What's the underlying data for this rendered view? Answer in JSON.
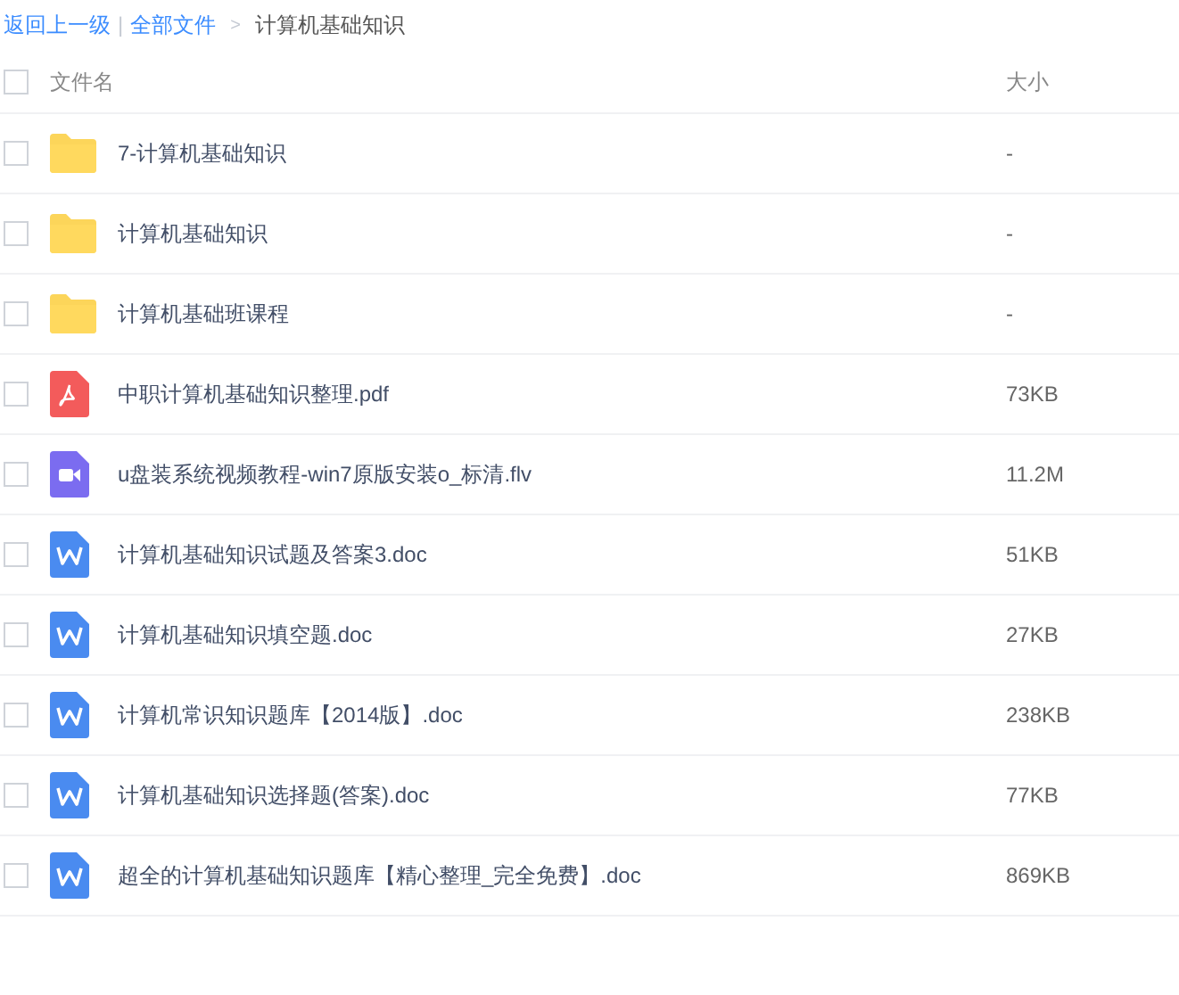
{
  "breadcrumb": {
    "back": "返回上一级",
    "divider": "|",
    "root": "全部文件",
    "separator": ">",
    "current": "计算机基础知识"
  },
  "table": {
    "columns": [
      "文件名",
      "大小"
    ],
    "header_checked": false,
    "rows": [
      {
        "kind": "folder",
        "name": "7-计算机基础知识",
        "size": "-",
        "checked": false
      },
      {
        "kind": "folder",
        "name": "计算机基础知识",
        "size": "-",
        "checked": false
      },
      {
        "kind": "folder",
        "name": "计算机基础班课程",
        "size": "-",
        "checked": false
      },
      {
        "kind": "pdf",
        "name": "中职计算机基础知识整理.pdf",
        "size": "73KB",
        "checked": false
      },
      {
        "kind": "video",
        "name": "u盘装系统视频教程-win7原版安装o_标清.flv",
        "size": "11.2M",
        "checked": false
      },
      {
        "kind": "doc",
        "name": "计算机基础知识试题及答案3.doc",
        "size": "51KB",
        "checked": false
      },
      {
        "kind": "doc",
        "name": "计算机基础知识填空题.doc",
        "size": "27KB",
        "checked": false
      },
      {
        "kind": "doc",
        "name": "计算机常识知识题库【2014版】.doc",
        "size": "238KB",
        "checked": false
      },
      {
        "kind": "doc",
        "name": "计算机基础知识选择题(答案).doc",
        "size": "77KB",
        "checked": false
      },
      {
        "kind": "doc",
        "name": "超全的计算机基础知识题库【精心整理_完全免费】.doc",
        "size": "869KB",
        "checked": false
      }
    ]
  }
}
